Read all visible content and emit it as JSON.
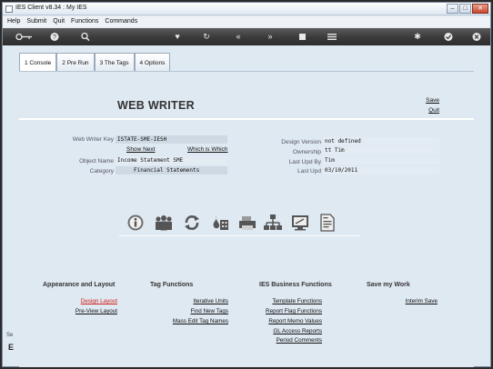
{
  "window": {
    "title": "IES Client v8.34 : My IES"
  },
  "menu": [
    "Help",
    "Submit",
    "Quit",
    "Functions",
    "Commands"
  ],
  "toolbar_icons": [
    "key-icon",
    "help-icon",
    "search-icon",
    "heart-icon",
    "refresh-icon",
    "rewind-icon",
    "forward-icon",
    "stop-icon",
    "menu-icon",
    "settings-icon",
    "check-icon",
    "close-icon"
  ],
  "tabs": [
    "1 Console",
    "2 Pre Run",
    "3 The Tags",
    "4 Options"
  ],
  "heading": "WEB WRITER",
  "actions": {
    "save": "Save",
    "quit": "Quit"
  },
  "form": {
    "key_label": "Web Writer Key",
    "key_value": "ISTATE-SME-IESH",
    "show_next": "Show Next",
    "which_is_which": "Which is Which",
    "object_label": "Object Name",
    "object_value": "Income Statement SME",
    "category_label": "Category",
    "category_value": "Financial Statements",
    "design_version_label": "Design Version",
    "design_version_value": "not defined",
    "ownership_label": "Ownership",
    "ownership_value": "tt Tim",
    "last_upd_by_label": "Last Upd By",
    "last_upd_by_value": "Tim",
    "last_upd_label": "Last Upd",
    "last_upd_value": "03/10/2011"
  },
  "sections": {
    "appearance": {
      "title": "Appearance and Layout",
      "items": [
        "Design Layout",
        "Pre-View Layout"
      ]
    },
    "tags": {
      "title": "Tag Functions",
      "items": [
        "Iterative Units",
        "Find New Tags",
        "Mass Edit Tag Names"
      ]
    },
    "business": {
      "title": "IES Business Functions",
      "items": [
        "Template Functions",
        "Report Flag Functions",
        "Report Memo Values",
        "GL Access Reports",
        "Period Comments"
      ]
    },
    "save": {
      "title": "Save my Work",
      "items": [
        "Interim Save"
      ]
    }
  },
  "side_text": "Se",
  "side_letter": "E",
  "colors": {
    "active_link": "#d21e1e",
    "toolbar": "#3a3a3a",
    "background": "#dfe9f2"
  }
}
